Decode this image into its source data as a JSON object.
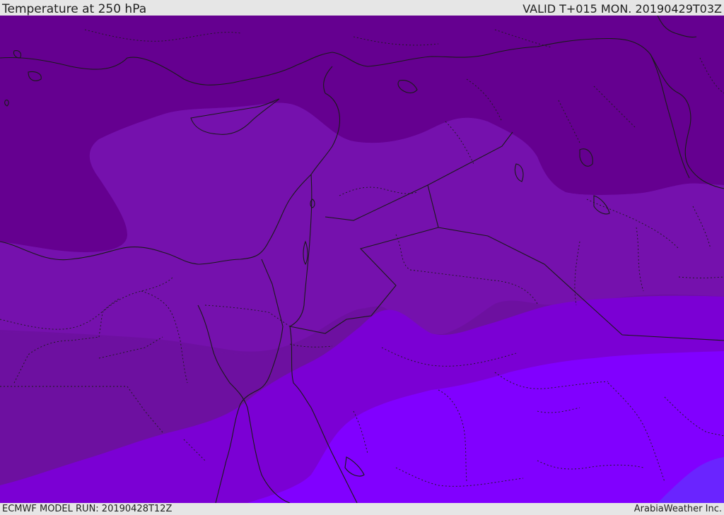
{
  "header": {
    "title": "Temperature at 250 hPa",
    "valid": "VALID T+015 MON. 20190429T03Z"
  },
  "footer": {
    "model_run": "ECMWF MODEL RUN: 20190428T12Z",
    "brand": "ArabiaWeather Inc."
  },
  "colors": {
    "coldest": "#650090",
    "cold": "#7511ad",
    "mid": "#6d10a0",
    "warm": "#7b00d4",
    "warmer": "#8100ff",
    "warmest": "#6a24ff",
    "border": "#1a1a1a"
  }
}
